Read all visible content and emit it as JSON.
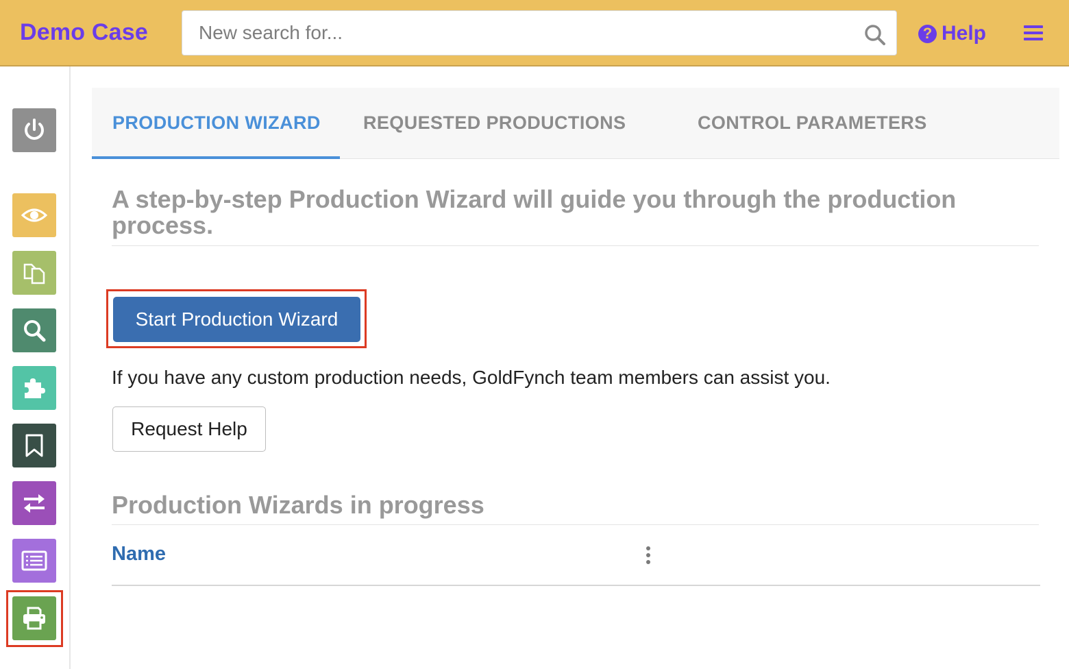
{
  "header": {
    "brand": "Demo Case",
    "search_placeholder": "New search for...",
    "help_label": "Help",
    "colors": {
      "bar": "#ecc05f",
      "accent": "#6a3de8"
    }
  },
  "sidebar": {
    "items": [
      {
        "name": "power",
        "icon": "power-icon",
        "color": "#8f8f8f"
      },
      {
        "name": "review",
        "icon": "eye-icon",
        "color": "#ecc05f"
      },
      {
        "name": "documents",
        "icon": "documents-icon",
        "color": "#a6bf6a"
      },
      {
        "name": "search",
        "icon": "search-icon",
        "color": "#4f8a6e"
      },
      {
        "name": "plugins",
        "icon": "puzzle-icon",
        "color": "#53c4a6"
      },
      {
        "name": "bookmarks",
        "icon": "bookmark-icon",
        "color": "#394f47"
      },
      {
        "name": "transfer",
        "icon": "transfer-icon",
        "color": "#9b4fb8"
      },
      {
        "name": "list",
        "icon": "list-icon",
        "color": "#a36fdc"
      },
      {
        "name": "production",
        "icon": "printer-icon",
        "color": "#6aa351",
        "selected": true
      }
    ]
  },
  "tabs": [
    {
      "label": "PRODUCTION WIZARD",
      "active": true
    },
    {
      "label": "REQUESTED PRODUCTIONS",
      "active": false
    },
    {
      "label": "CONTROL PARAMETERS",
      "active": false
    }
  ],
  "main": {
    "intro": "A step-by-step Production Wizard will guide you through the production process.",
    "start_button": "Start Production Wizard",
    "custom_text": "If you have any custom production needs, GoldFynch team members can assist you.",
    "request_button": "Request Help",
    "in_progress_title": "Production Wizards in progress",
    "table": {
      "columns": [
        "Name"
      ]
    }
  }
}
